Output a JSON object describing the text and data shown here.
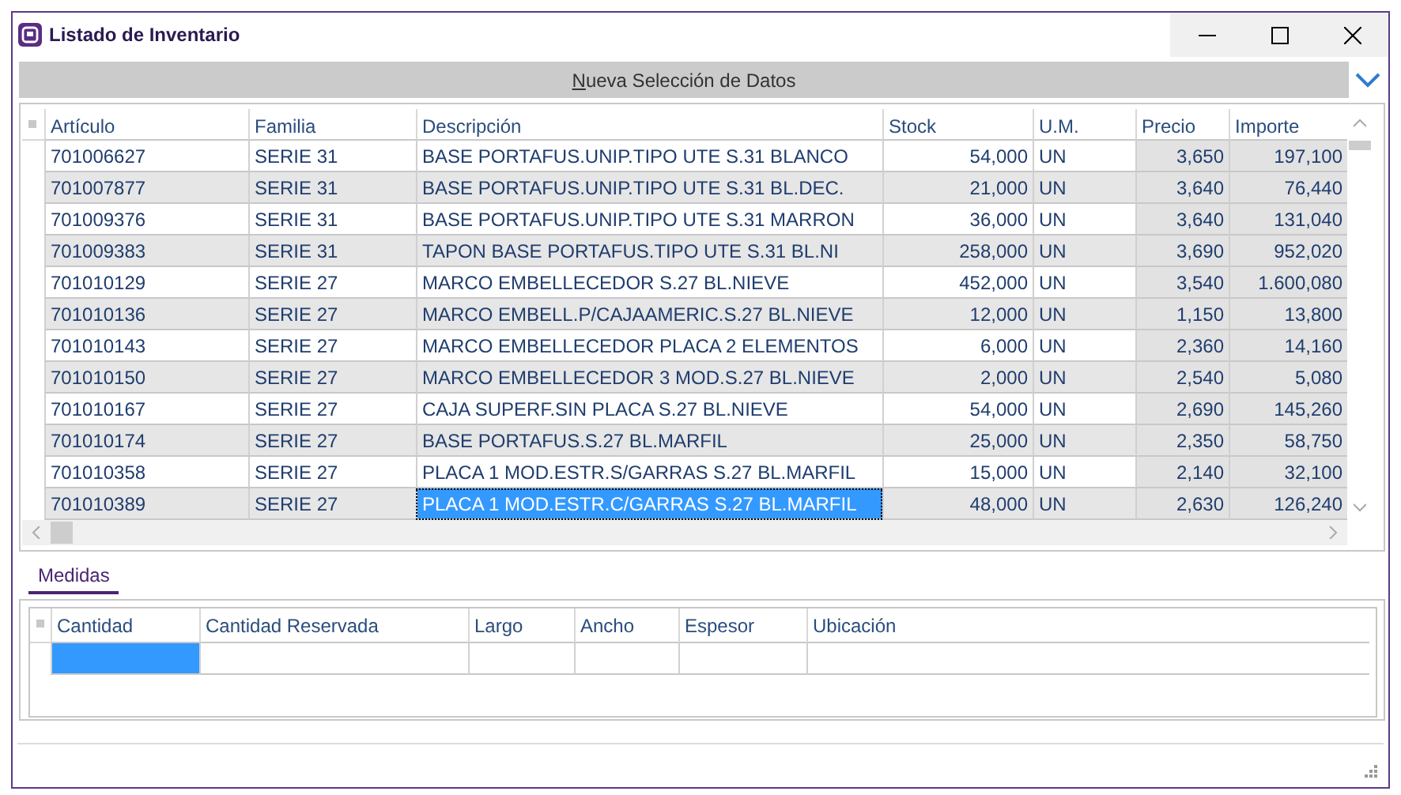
{
  "window": {
    "title": "Listado de Inventario"
  },
  "banner": {
    "label": "Nueva Selección de Datos"
  },
  "table": {
    "columns": [
      {
        "label": "Artículo",
        "kind": "text",
        "shaded": false,
        "focused": false
      },
      {
        "label": "Familia",
        "kind": "text",
        "shaded": false,
        "focused": false
      },
      {
        "label": "Descripción",
        "kind": "text",
        "shaded": false,
        "focused": true
      },
      {
        "label": "Stock",
        "kind": "number",
        "shaded": false,
        "focused": false
      },
      {
        "label": "U.M.",
        "kind": "text",
        "shaded": false,
        "focused": false
      },
      {
        "label": "Precio",
        "kind": "number",
        "shaded": true,
        "focused": false
      },
      {
        "label": "Importe",
        "kind": "number",
        "shaded": true,
        "focused": false
      }
    ],
    "rows": [
      {
        "selected": false,
        "cells": [
          "701006627",
          "SERIE 31",
          "BASE PORTAFUS.UNIP.TIPO UTE S.31 BLANCO",
          "54,000",
          "UN",
          "3,650",
          "197,100"
        ]
      },
      {
        "selected": false,
        "cells": [
          "701007877",
          "SERIE 31",
          "BASE PORTAFUS.UNIP.TIPO UTE S.31 BL.DEC.",
          "21,000",
          "UN",
          "3,640",
          "76,440"
        ]
      },
      {
        "selected": false,
        "cells": [
          "701009376",
          "SERIE 31",
          "BASE PORTAFUS.UNIP.TIPO UTE S.31 MARRON",
          "36,000",
          "UN",
          "3,640",
          "131,040"
        ]
      },
      {
        "selected": false,
        "cells": [
          "701009383",
          "SERIE 31",
          "TAPON BASE PORTAFUS.TIPO UTE S.31 BL.NI",
          "258,000",
          "UN",
          "3,690",
          "952,020"
        ]
      },
      {
        "selected": false,
        "cells": [
          "701010129",
          "SERIE 27",
          "MARCO EMBELLECEDOR S.27 BL.NIEVE",
          "452,000",
          "UN",
          "3,540",
          "1.600,080"
        ]
      },
      {
        "selected": false,
        "cells": [
          "701010136",
          "SERIE 27",
          "MARCO EMBELL.P/CAJAAMERIC.S.27 BL.NIEVE",
          "12,000",
          "UN",
          "1,150",
          "13,800"
        ]
      },
      {
        "selected": false,
        "cells": [
          "701010143",
          "SERIE 27",
          "MARCO EMBELLECEDOR PLACA 2 ELEMENTOS",
          "6,000",
          "UN",
          "2,360",
          "14,160"
        ]
      },
      {
        "selected": false,
        "cells": [
          "701010150",
          "SERIE 27",
          "MARCO EMBELLECEDOR 3 MOD.S.27 BL.NIEVE",
          "2,000",
          "UN",
          "2,540",
          "5,080"
        ]
      },
      {
        "selected": false,
        "cells": [
          "701010167",
          "SERIE 27",
          "CAJA SUPERF.SIN PLACA S.27 BL.NIEVE",
          "54,000",
          "UN",
          "2,690",
          "145,260"
        ]
      },
      {
        "selected": false,
        "cells": [
          "701010174",
          "SERIE 27",
          "BASE PORTAFUS.S.27 BL.MARFIL",
          "25,000",
          "UN",
          "2,350",
          "58,750"
        ]
      },
      {
        "selected": false,
        "cells": [
          "701010358",
          "SERIE 27",
          "PLACA 1 MOD.ESTR.S/GARRAS S.27 BL.MARFIL",
          "15,000",
          "UN",
          "2,140",
          "32,100"
        ]
      },
      {
        "selected": true,
        "cells": [
          "701010389",
          "SERIE 27",
          "PLACA 1 MOD.ESTR.C/GARRAS S.27 BL.MARFIL",
          "48,000",
          "UN",
          "2,630",
          "126,240"
        ]
      }
    ]
  },
  "tabs": [
    {
      "label": "Medidas",
      "selected": true
    }
  ],
  "detail_table": {
    "columns": [
      {
        "label": "Cantidad",
        "focused": true
      },
      {
        "label": "Cantidad Reservada",
        "focused": false
      },
      {
        "label": "Largo",
        "focused": false
      },
      {
        "label": "Ancho",
        "focused": false
      },
      {
        "label": "Espesor",
        "focused": false
      },
      {
        "label": "Ubicación",
        "focused": false
      }
    ],
    "rows": [
      {
        "selected": true
      }
    ]
  }
}
